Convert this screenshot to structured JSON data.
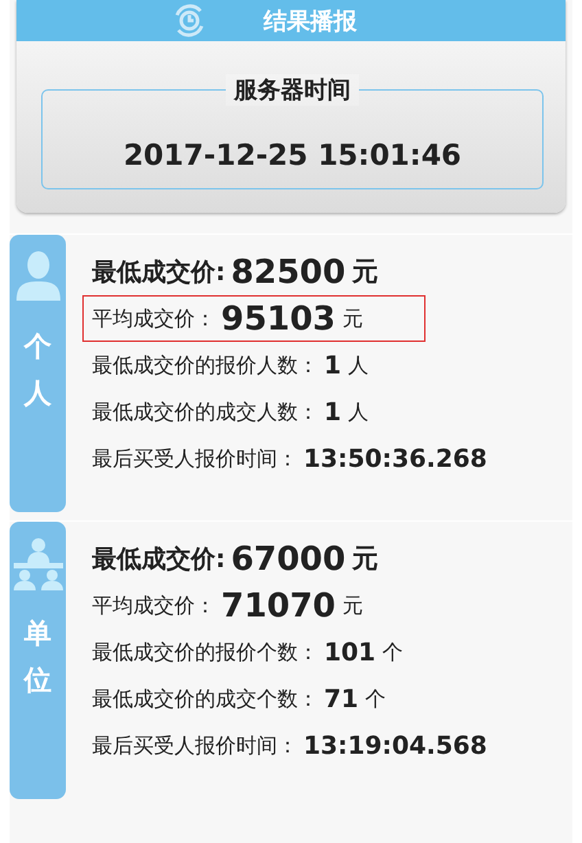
{
  "header": {
    "title": "结果播报",
    "server_time": {
      "label": "服务器时间",
      "value": "2017-12-25 15:01:46"
    }
  },
  "sections": [
    {
      "tab_label": "个人",
      "kind": "person",
      "rows": [
        {
          "kind": "headline",
          "label": "最低成交价:",
          "value": "82500",
          "unit": "元",
          "highlighted": false
        },
        {
          "kind": "large",
          "label": "平均成交价：",
          "value": "95103",
          "unit": "元",
          "highlighted": true
        },
        {
          "kind": "plain",
          "label": "最低成交价的报价人数：",
          "value": "1",
          "unit": "人",
          "highlighted": false
        },
        {
          "kind": "plain",
          "label": "最低成交价的成交人数：",
          "value": "1",
          "unit": "人",
          "highlighted": false
        },
        {
          "kind": "plain",
          "label": "最后买受人报价时间：",
          "value": "13:50:36.268",
          "highlighted": false
        }
      ]
    },
    {
      "tab_label": "单位",
      "kind": "group",
      "rows": [
        {
          "kind": "headline",
          "label": "最低成交价:",
          "value": "67000",
          "unit": "元",
          "highlighted": false
        },
        {
          "kind": "large",
          "label": "平均成交价：",
          "value": "71070",
          "unit": "元",
          "highlighted": false
        },
        {
          "kind": "plain",
          "label": "最低成交价的报价个数：",
          "value": "101",
          "unit": "个",
          "highlighted": false
        },
        {
          "kind": "plain",
          "label": "最低成交价的成交个数：",
          "value": "71",
          "unit": "个",
          "highlighted": false
        },
        {
          "kind": "plain",
          "label": "最后买受人报价时间：",
          "value": "13:19:04.568",
          "highlighted": false
        }
      ]
    }
  ]
}
